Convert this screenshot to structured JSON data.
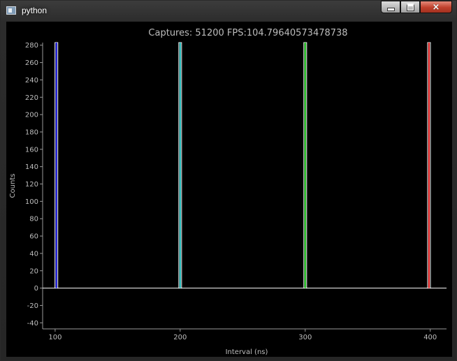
{
  "window": {
    "title": "python"
  },
  "controls": {
    "minimize": "minimize",
    "maximize": "maximize",
    "close": "×"
  },
  "chart_data": {
    "type": "bar",
    "title": "Captures: 51200 FPS:104.79640573478738",
    "xlabel": "Interval (ns)",
    "ylabel": "Counts",
    "xlim": [
      90,
      413
    ],
    "ylim": [
      -47,
      283
    ],
    "x_ticks": [
      100,
      200,
      300,
      400
    ],
    "y_ticks": [
      280,
      260,
      240,
      220,
      200,
      180,
      160,
      140,
      120,
      100,
      80,
      60,
      40,
      20,
      0,
      -20,
      -40
    ],
    "baseline": 0,
    "series": [
      {
        "x": 101,
        "value": 283,
        "color": "#2a2aff"
      },
      {
        "x": 200,
        "value": 283,
        "color": "#35d6d6"
      },
      {
        "x": 300,
        "value": 283,
        "color": "#2ee02e"
      },
      {
        "x": 399,
        "value": 283,
        "color": "#ff3030"
      }
    ],
    "colors": {
      "background": "#000000",
      "axis": "#9a9a9a",
      "text": "#bdbdbd",
      "baseline": "#ffffff"
    }
  }
}
